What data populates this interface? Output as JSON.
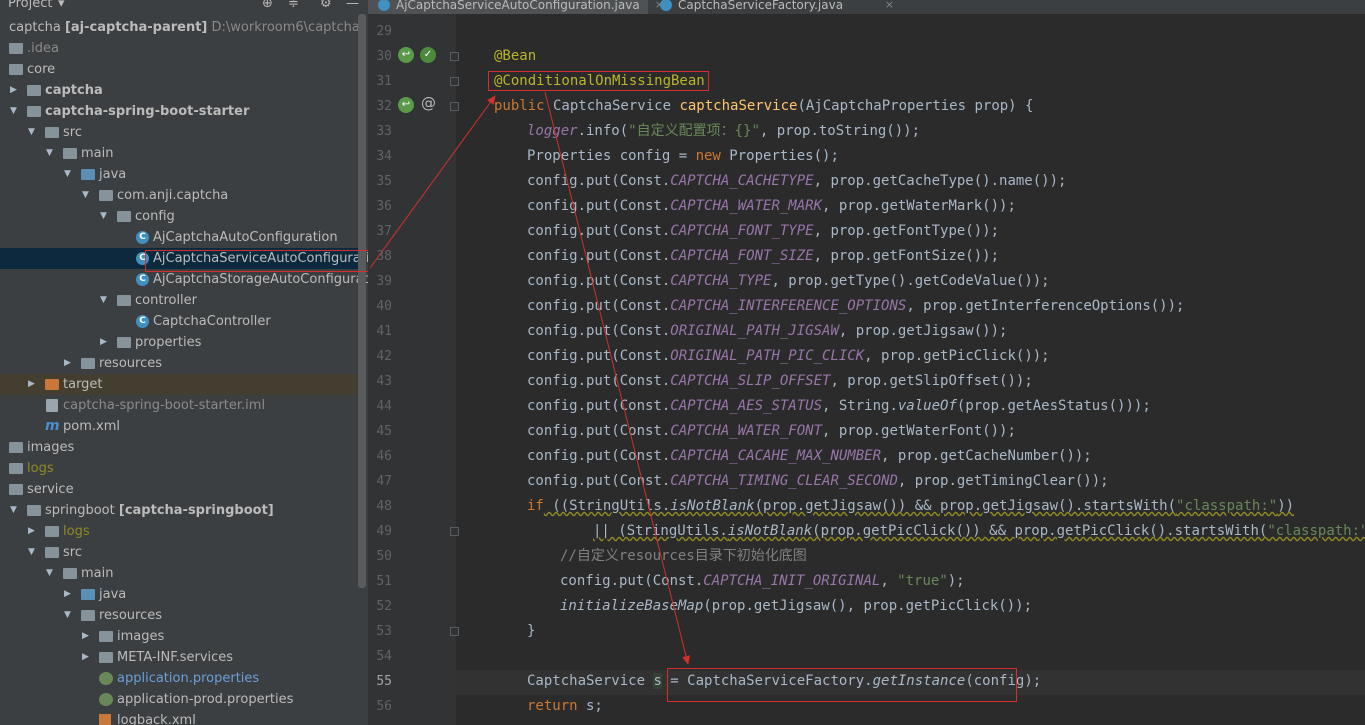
{
  "project_panel": {
    "title": "Project",
    "tree": [
      {
        "label": "captcha",
        "extra": "[aj-captcha-parent]",
        "path": "D:\\workroom6\\captcha"
      },
      {
        "label": ".idea"
      },
      {
        "label": "core"
      },
      {
        "label": "captcha"
      },
      {
        "label": "captcha-spring-boot-starter"
      },
      {
        "label": "src"
      },
      {
        "label": "main"
      },
      {
        "label": "java"
      },
      {
        "label": "com.anji.captcha"
      },
      {
        "label": "config"
      },
      {
        "label": "AjCaptchaAutoConfiguration"
      },
      {
        "label": "AjCaptchaServiceAutoConfiguration"
      },
      {
        "label": "AjCaptchaStorageAutoConfiguration"
      },
      {
        "label": "controller"
      },
      {
        "label": "CaptchaController"
      },
      {
        "label": "properties"
      },
      {
        "label": "resources"
      },
      {
        "label": "target"
      },
      {
        "label": "captcha-spring-boot-starter.iml"
      },
      {
        "label": "pom.xml"
      },
      {
        "label": "images"
      },
      {
        "label": "logs"
      },
      {
        "label": "service"
      },
      {
        "label": "springboot",
        "extra": "[captcha-springboot]"
      },
      {
        "label": "logs"
      },
      {
        "label": "src"
      },
      {
        "label": "main"
      },
      {
        "label": "java"
      },
      {
        "label": "resources"
      },
      {
        "label": "images"
      },
      {
        "label": "META-INF.services"
      },
      {
        "label": "application.properties"
      },
      {
        "label": "application-prod.properties"
      },
      {
        "label": "logback.xml"
      }
    ]
  },
  "tabs": [
    {
      "label": "AjCaptchaServiceAutoConfiguration.java"
    },
    {
      "label": "CaptchaServiceFactory.java"
    }
  ],
  "editor": {
    "line_numbers": [
      "29",
      "30",
      "31",
      "32",
      "33",
      "34",
      "35",
      "36",
      "37",
      "38",
      "39",
      "40",
      "41",
      "42",
      "43",
      "44",
      "45",
      "46",
      "47",
      "48",
      "49",
      "50",
      "51",
      "52",
      "53",
      "54",
      "55",
      "56"
    ],
    "current_line": "55",
    "code": {
      "l30": "@Bean",
      "l31": "@ConditionalOnMissingBean",
      "l32_kw": "public",
      "l32_type": " CaptchaService ",
      "l32_fn": "captchaService",
      "l32_rest": "(AjCaptchaProperties prop) {",
      "l33_a": "logger",
      "l33_b": ".info(",
      "l33_str": "\"自定义配置项：{}\"",
      "l33_c": ", prop.toString());",
      "l34_a": "Properties config = ",
      "l34_kw": "new",
      "l34_b": " Properties();",
      "put_prefix": "config.put(Const.",
      "puts": [
        {
          "const": "CAPTCHA_CACHETYPE",
          "rest": ", prop.getCacheType().name());"
        },
        {
          "const": "CAPTCHA_WATER_MARK",
          "rest": ", prop.getWaterMark());"
        },
        {
          "const": "CAPTCHA_FONT_TYPE",
          "rest": ", prop.getFontType());"
        },
        {
          "const": "CAPTCHA_FONT_SIZE",
          "rest": ", prop.getFontSize());"
        },
        {
          "const": "CAPTCHA_TYPE",
          "rest": ", prop.getType().getCodeValue());"
        },
        {
          "const": "CAPTCHA_INTERFERENCE_OPTIONS",
          "rest": ", prop.getInterferenceOptions());"
        },
        {
          "const": "ORIGINAL_PATH_JIGSAW",
          "rest": ", prop.getJigsaw());"
        },
        {
          "const": "ORIGINAL_PATH_PIC_CLICK",
          "rest": ", prop.getPicClick());"
        },
        {
          "const": "CAPTCHA_SLIP_OFFSET",
          "rest": ", prop.getSlipOffset());"
        },
        {
          "const": "CAPTCHA_AES_STATUS",
          "rest": ", String.",
          "it": "valueOf",
          "rest2": "(prop.getAesStatus()));"
        },
        {
          "const": "CAPTCHA_WATER_FONT",
          "rest": ", prop.getWaterFont());"
        },
        {
          "const": "CAPTCHA_CACAHE_MAX_NUMBER",
          "rest": ", prop.getCacheNumber());"
        },
        {
          "const": "CAPTCHA_TIMING_CLEAR_SECOND",
          "rest": ", prop.getTimingClear());"
        }
      ],
      "l48_kw": "if",
      "l48_a": " ((StringUtils.",
      "l48_it": "isNotBlank",
      "l48_b": "(prop.getJigsaw()) && prop.getJigsaw().startsWith(",
      "l48_str": "\"classpath:\"",
      "l48_c": "))",
      "l49_a": "|| (StringUtils.",
      "l49_it": "isNotBlank",
      "l49_b": "(prop.getPicClick()) && prop.getPicClick().startsWith(",
      "l49_str": "\"classpath:\"",
      "l49_c": "))) {",
      "l50": "//自定义resources目录下初始化底图",
      "l51_a": "config.put(Const.",
      "l51_const": "CAPTCHA_INIT_ORIGINAL",
      "l51_b": ", ",
      "l51_str": "\"true\"",
      "l51_c": ");",
      "l52_it": "initializeBaseMap",
      "l52_b": "(prop.getJigsaw(), prop.getPicClick());",
      "l53": "}",
      "l55_a": "CaptchaService ",
      "l55_var": "s",
      "l55_b": " = CaptchaServiceFactory.",
      "l55_it": "getInstance",
      "l55_c": "(config);",
      "l56_kw": "return",
      "l56_b": " s;"
    }
  },
  "colors": {
    "annotation_box": "#d0312d",
    "keyword": "#cc7832",
    "annotation": "#bbb529",
    "method_decl": "#ffc66d",
    "string": "#6a8759",
    "constant": "#9876aa"
  }
}
